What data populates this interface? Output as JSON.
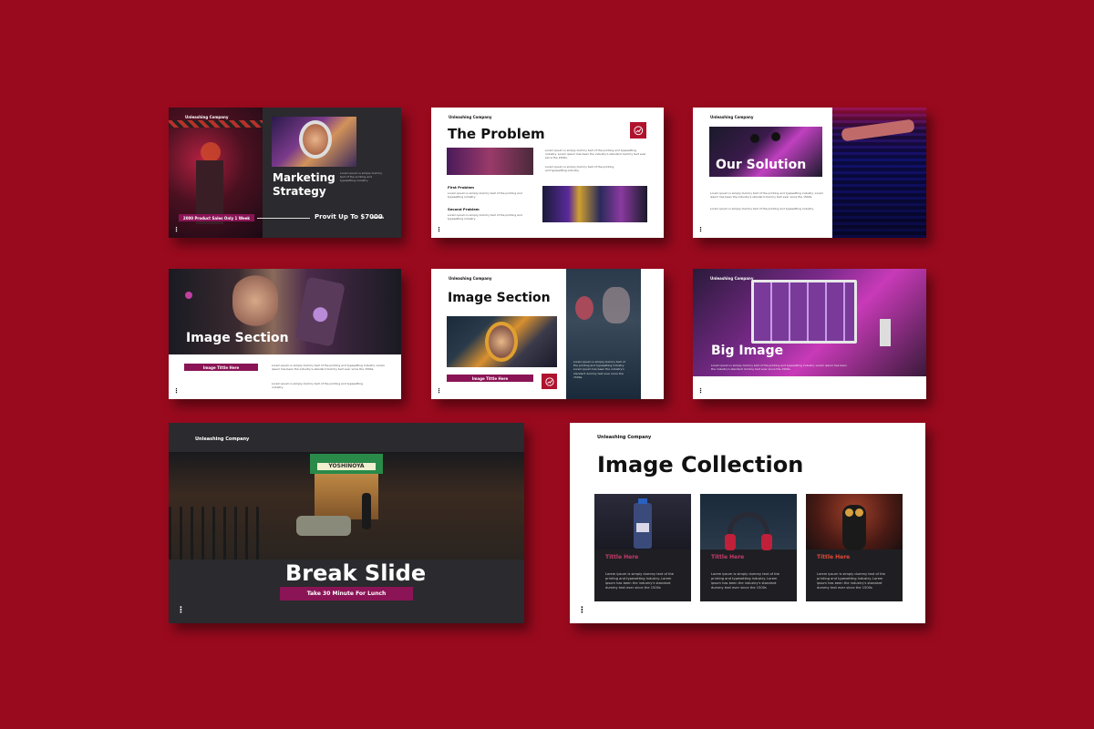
{
  "company": "Unleashing Company",
  "colors": {
    "background": "#9a0a1e",
    "accent": "#8a1456",
    "logo": "#b0132d",
    "slide_dark": "#2b2a2e"
  },
  "lorem_short": "Lorem ipsum is simply dummy text of the printing and typesetting industry.",
  "lorem_long": "Lorem ipsum is simply dummy text of the printing and typesetting industry. Lorem ipsum has been the industry's standard dummy text ever since the 1500s.",
  "slides": {
    "marketing": {
      "title": "Marketing Strategy",
      "badge": "2000 Product Sales Only 1 Week",
      "profit": "Provit Up To $7000",
      "profit_unit": "/month"
    },
    "problem": {
      "title": "The Problem",
      "first": "First Problem",
      "second": "Second Problem"
    },
    "solution": {
      "title": "Our Solution"
    },
    "image_section_a": {
      "title": "Image Section",
      "pill": "Image Tittle Here"
    },
    "image_section_b": {
      "title": "Image Section",
      "pill": "Image Tittle Here"
    },
    "big_image": {
      "title": "Big Image"
    },
    "break": {
      "title": "Break Slide",
      "pill": "Take 30 Minute For Lunch",
      "sign_main": "YOSHINOYA"
    },
    "collection": {
      "title": "Image Collection",
      "cards": [
        {
          "title": "Tittle Here",
          "text": "Lorem ipsum is simply dummy text of the printing and typesetting industry. Lorem ipsum has been the industry's standard dummy text ever since the 1500s"
        },
        {
          "title": "Tittle Here",
          "text": "Lorem ipsum is simply dummy text of the printing and typesetting industry. Lorem ipsum has been the industry's standard dummy text ever since the 1500s"
        },
        {
          "title": "Tittle Here",
          "text": "Lorem ipsum is simply dummy text of the printing and typesetting industry. Lorem ipsum has been the industry's standard dummy text ever since the 1500s"
        }
      ]
    }
  },
  "icons": {
    "logo": "chart-arrow-icon",
    "menu": "vertical-dots-icon"
  }
}
